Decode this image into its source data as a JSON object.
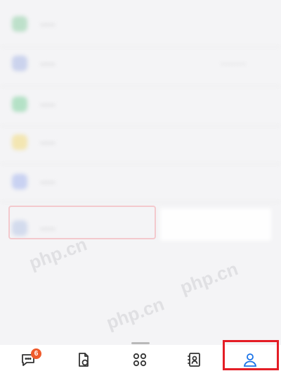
{
  "menu": {
    "items": [
      {
        "label": "·····",
        "color": "#8fd0a5"
      },
      {
        "label": "·····",
        "color": "#a9b8e6",
        "extra": "·········"
      },
      {
        "label": "·····",
        "color": "#7fd19f"
      },
      {
        "label": "·····",
        "color": "#f3da7a"
      },
      {
        "label": "·····",
        "color": "#a6b7ef"
      },
      {
        "label": "·····",
        "color": "#b8c6e6"
      }
    ]
  },
  "watermark": "php.cn",
  "tabbar": {
    "tabs": [
      {
        "name": "messages",
        "icon": "chat-bubble-icon"
      },
      {
        "name": "documents",
        "icon": "document-icon"
      },
      {
        "name": "workbench",
        "icon": "apps-grid-icon"
      },
      {
        "name": "contacts",
        "icon": "contacts-book-icon"
      },
      {
        "name": "me",
        "icon": "person-icon",
        "active": true
      }
    ],
    "messages_badge": "6",
    "active_color": "#1a73e8",
    "badge_color": "#ef5a2b",
    "highlight_color": "#e41d25"
  }
}
